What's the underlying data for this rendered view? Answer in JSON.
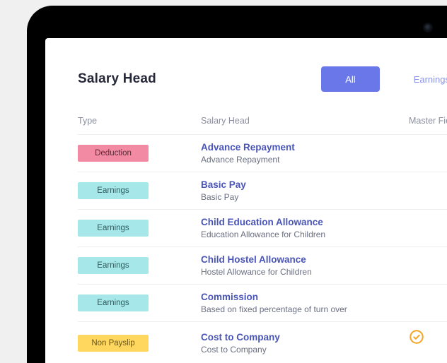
{
  "header": {
    "title": "Salary Head",
    "tabs": [
      {
        "label": "All",
        "active": true
      },
      {
        "label": "Earnings",
        "active": false
      }
    ]
  },
  "columns": {
    "type": "Type",
    "salary_head": "Salary Head",
    "master_field": "Master Field"
  },
  "badge_labels": {
    "deduction": "Deduction",
    "earnings": "Earnings",
    "nonpayslip": "Non Payslip"
  },
  "colors": {
    "accent": "#6a77e8",
    "badge_deduction": "#f38aa3",
    "badge_earnings": "#a6e8ea",
    "badge_nonpayslip": "#ffd75e",
    "check_icon": "#f4a522"
  },
  "rows": [
    {
      "type": "deduction",
      "name": "Advance Repayment",
      "sub": "Advance Repayment",
      "checked": false
    },
    {
      "type": "earnings",
      "name": "Basic Pay",
      "sub": "Basic Pay",
      "checked": false
    },
    {
      "type": "earnings",
      "name": "Child Education Allowance",
      "sub": "Education Allowance for Children",
      "checked": false
    },
    {
      "type": "earnings",
      "name": "Child Hostel Allowance",
      "sub": "Hostel Allowance for Children",
      "checked": false
    },
    {
      "type": "earnings",
      "name": "Commission",
      "sub": "Based on fixed percentage of turn over",
      "checked": false
    },
    {
      "type": "nonpayslip",
      "name": "Cost to Company",
      "sub": "Cost to Company",
      "checked": true
    }
  ]
}
